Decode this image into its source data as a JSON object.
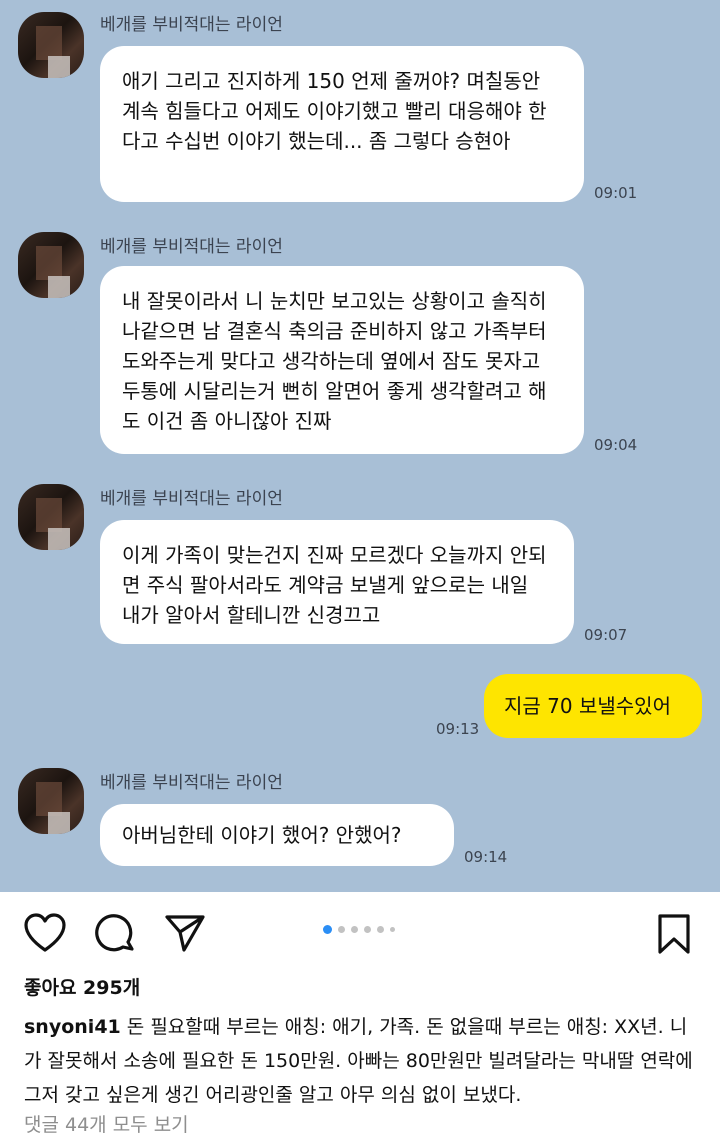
{
  "chat": {
    "messages": [
      {
        "sender": "베개를 부비적대는 라이언",
        "text": "애기 그리고 진지하게 150 언제 줄꺼야? 며칠동안 계속 힘들다고 어제도 이야기했고 빨리 대응해야 한다고 수십번 이야기 했는데... 좀 그렇다 승현아",
        "time": "09:01"
      },
      {
        "sender": "베개를 부비적대는 라이언",
        "text": "내 잘못이라서 니 눈치만 보고있는 상황이고 솔직히 나같으면 남 결혼식 축의금 준비하지 않고 가족부터 도와주는게 맞다고 생각하는데 옆에서 잠도 못자고 두통에 시달리는거 뻔히 알면어 좋게 생각할려고 해도 이건 좀 아니잖아 진짜",
        "time": "09:04"
      },
      {
        "sender": "베개를 부비적대는 라이언",
        "text": "이게 가족이 맞는건지 진짜 모르겠다 오늘까지 안되면 주식 팔아서라도 계약금 보낼게 앞으로는 내일 내가 알아서 할테니깐 신경끄고",
        "time": "09:07"
      },
      {
        "text": "지금 70 보낼수있어",
        "time": "09:13"
      },
      {
        "sender": "베개를 부비적대는 라이언",
        "text": "아버님한테 이야기 했어? 안했어?",
        "time": "09:14"
      }
    ]
  },
  "post": {
    "likes": "좋아요 295개",
    "username": "snyoni41",
    "caption": " 돈 필요할때 부르는 애칭: 애기, 가족. 돈 없을때 부르는 애칭: XX년. 니가 잘못해서 소송에 필요한 돈 150만원. 아빠는 80만원만 빌려달라는 막내딸 연락에 그저 갖고 싶은게 생긴 어리광인줄 알고 아무 의심 없이 보냈다.",
    "comments_link": "댓글 44개 모두 보기",
    "icons": [
      "heart-icon",
      "comment-icon",
      "share-icon",
      "bookmark-icon"
    ],
    "carousel": {
      "total": 6,
      "active": 1
    }
  },
  "colors": {
    "chat_background": "#a8bfd6",
    "my_bubble": "#fee500",
    "their_bubble": "#ffffff",
    "carousel_active": "#2b8ef5"
  }
}
